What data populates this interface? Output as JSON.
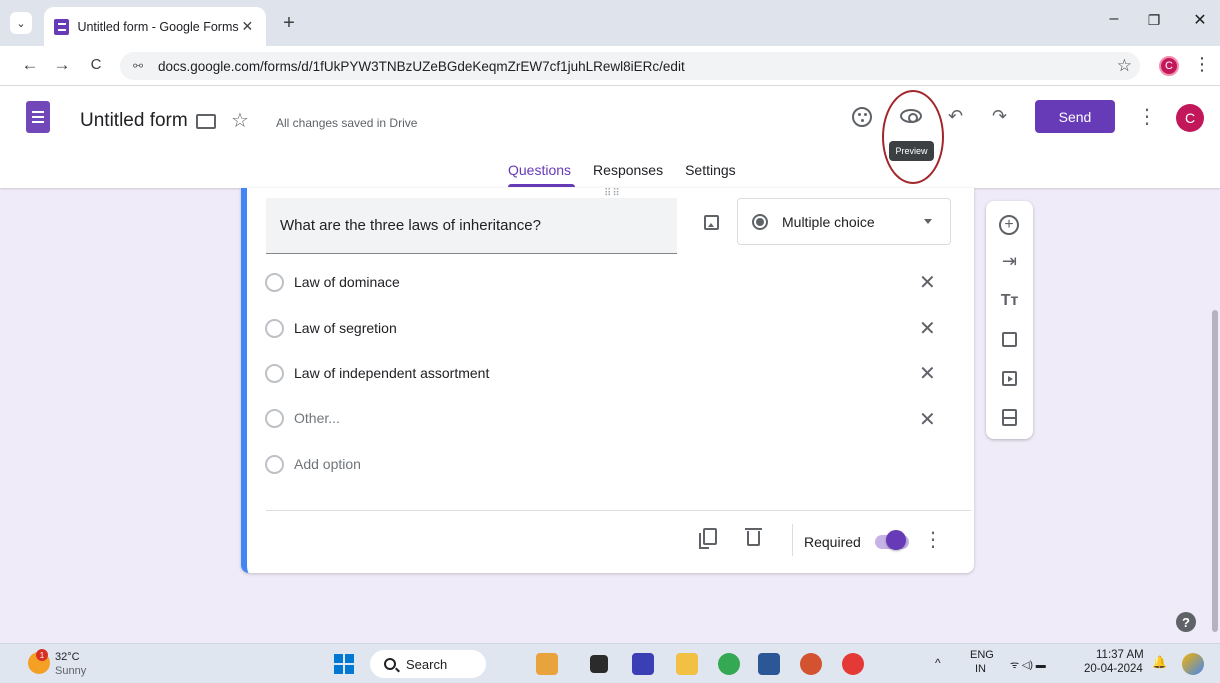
{
  "browser": {
    "tab_list_icon": "chevron-down-icon",
    "tab_title": "Untitled form - Google Forms",
    "tab_close": "✕",
    "new_tab": "+",
    "win_minimize": "–",
    "win_restore": "❐",
    "win_close": "✕",
    "back": "←",
    "forward": "→",
    "reload": "C",
    "site_info": "⚯",
    "url": "docs.google.com/forms/d/1fUkPYW3TNBzUZeBGdeKeqmZrEW7cf1juhLRewl8iERc/edit",
    "bookmark_star": "☆",
    "profile_initial": "C",
    "menu": "⋮"
  },
  "forms_header": {
    "title": "Untitled form",
    "star": "☆",
    "saved_status": "All changes saved in Drive",
    "tooltip": "Preview",
    "undo": "↶",
    "redo": "↷",
    "send_label": "Send",
    "more": "⋮",
    "avatar_initial": "C",
    "tabs": [
      {
        "label": "Questions",
        "active": true
      },
      {
        "label": "Responses",
        "active": false
      },
      {
        "label": "Settings",
        "active": false
      }
    ]
  },
  "question": {
    "drag_handle": "⠿⠿",
    "title": "What are the three laws of inheritance?",
    "type": "Multiple choice",
    "options": [
      {
        "label": "Law of dominace"
      },
      {
        "label": "Law of segretion"
      },
      {
        "label": "Law of independent assortment"
      },
      {
        "label": "Other..."
      }
    ],
    "add_option": "Add option",
    "remove": "✕",
    "required_label": "Required",
    "required": true,
    "more": "⋮"
  },
  "side_toolbar": {
    "add": "+",
    "import": "⇥",
    "text": "Tт"
  },
  "help": "?",
  "taskbar": {
    "weather_badge": "1",
    "temperature": "32°C",
    "condition": "Sunny",
    "search_label": "Search",
    "lang_top": "ENG",
    "lang_bottom": "IN",
    "tray_icons": "ᯤ ◁) ▬",
    "time": "11:37 AM",
    "date": "20-04-2024",
    "bell": "🔔"
  },
  "colors": {
    "forms_purple": "#673ab7",
    "page_bg": "#f0ebf8",
    "card_accent": "#4285f4",
    "annotation": "#a3262a"
  }
}
